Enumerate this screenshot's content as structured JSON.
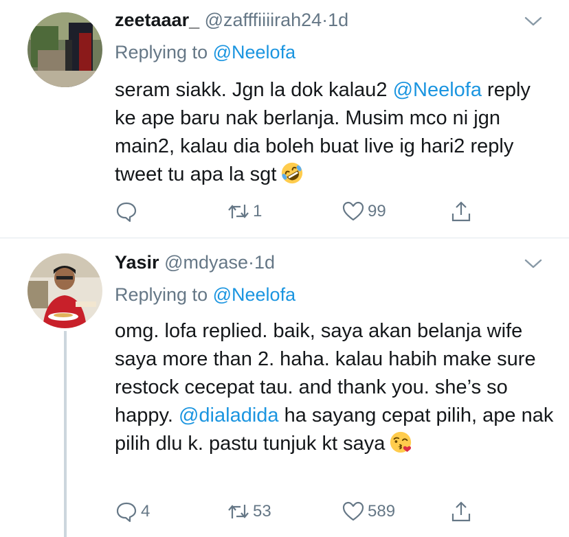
{
  "tweets": [
    {
      "name": "zeetaaar_",
      "handle": "@zafffiiiirah24",
      "separator": "·",
      "time": "1d",
      "replying_prefix": "Replying to",
      "replying_to": "@Neelofa",
      "text_parts": [
        "seram siakk. Jgn la dok kalau2 ",
        "@Neelofa",
        " reply ke ape baru nak berlanja. Musim mco ni jgn main2, kalau dia boleh buat live ig hari2 reply tweet tu apa la sgt"
      ],
      "emoji": "rolling-on-the-floor-laughing",
      "reply_count": "",
      "retweet_count": "1",
      "like_count": "99"
    },
    {
      "name": "Yasir",
      "handle": "@mdyase",
      "separator": "·",
      "time": "1d",
      "replying_prefix": "Replying to",
      "replying_to": "@Neelofa",
      "text_parts": [
        "omg. lofa replied. baik, saya akan belanja wife saya more than 2. haha. kalau habih make sure restock cecepat tau. and thank you. she’s so happy. ",
        "@dialadida",
        " ha sayang cepat pilih, ape nak pilih dlu k. pastu tunjuk kt saya"
      ],
      "emoji": "face-blowing-a-kiss",
      "reply_count": "4",
      "retweet_count": "53",
      "like_count": "589"
    }
  ],
  "colors": {
    "text": "#14171a",
    "secondary": "#657786",
    "link": "#1b95e0",
    "divider": "#e1e8ed",
    "thread_line": "#ccd6dd"
  }
}
